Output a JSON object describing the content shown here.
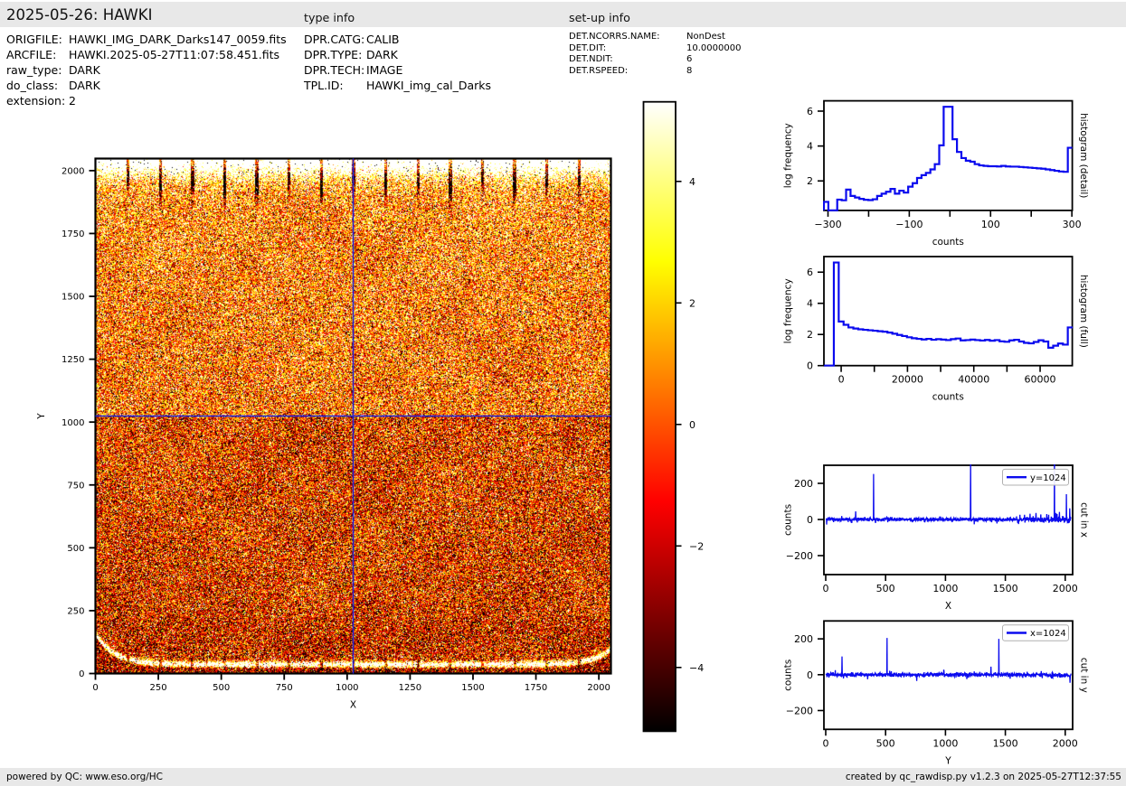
{
  "header": {
    "title": "2025-05-26: HAWKI",
    "type_info_heading": "type info",
    "setup_info_heading": "set-up info"
  },
  "file_info": {
    "rows": [
      {
        "label": "ORIGFILE:",
        "value": "HAWKI_IMG_DARK_Darks147_0059.fits"
      },
      {
        "label": "ARCFILE:",
        "value": "HAWKI.2025-05-27T11:07:58.451.fits"
      },
      {
        "label": "raw_type:",
        "value": "DARK"
      },
      {
        "label": "do_class:",
        "value": "DARK"
      },
      {
        "label": "extension:",
        "value": "2"
      }
    ]
  },
  "type_info": {
    "rows": [
      {
        "label": "DPR.CATG:",
        "value": "CALIB"
      },
      {
        "label": "DPR.TYPE:",
        "value": "DARK"
      },
      {
        "label": "DPR.TECH:",
        "value": "IMAGE"
      },
      {
        "label": "TPL.ID:",
        "value": "HAWKI_img_cal_Darks"
      }
    ]
  },
  "setup_info": {
    "rows": [
      {
        "label": "DET.NCORRS.NAME:",
        "value": "NonDest"
      },
      {
        "label": "DET.DIT:",
        "value": "10.0000000"
      },
      {
        "label": "DET.NDIT:",
        "value": "6"
      },
      {
        "label": "DET.RSPEED:",
        "value": "8"
      }
    ]
  },
  "footer": {
    "left": "powered by QC: www.eso.org/HC",
    "right": "created by qc_rawdisp.py v1.2.3 on 2025-05-27T12:37:55"
  },
  "colors": {
    "line_blue": "#0b0bee",
    "crosshair_blue": "#2222d6",
    "bar_gray": "#e8e8e8",
    "legend_edge": "#b0b0b0",
    "black": "#000000"
  },
  "chart_data": [
    {
      "name": "detector_image",
      "type": "heatmap",
      "xlabel": "X",
      "ylabel": "Y",
      "xlim": [
        0,
        2048
      ],
      "ylim": [
        0,
        2048
      ],
      "xticks": [
        0,
        250,
        500,
        750,
        1000,
        1250,
        1500,
        1750,
        2000
      ],
      "yticks": [
        0,
        250,
        500,
        750,
        1000,
        1250,
        1500,
        1750,
        2000
      ],
      "colormap": "hot",
      "clim": [
        -5.05,
        5.31
      ],
      "crosshair": {
        "x": 1024,
        "y": 1024
      },
      "colorbar_ticks": [
        {
          "v": 4,
          "l": "4"
        },
        {
          "v": 2,
          "l": "2"
        },
        {
          "v": 0,
          "l": "0"
        },
        {
          "v": -2,
          "l": "−2"
        },
        {
          "v": -4,
          "l": "−4"
        }
      ],
      "features": {
        "description": "noisy dark-frame with bright top edge band, dark channel streaks every 128 px hanging from the top, brighter upper half, darker lower half, bright curved band near the bottom edge and faint bright columns",
        "seed": 1234567,
        "noise_sigma": 2.85,
        "upper_mean": 0.6,
        "upper_grad": 0.7,
        "lower_mean": -0.55,
        "lower_grad": -0.4,
        "top_band_amp": 7.5,
        "top_band_scale": 60,
        "top_fade_amp": 1.6,
        "top_fade_scale": 140,
        "streak_every": 128,
        "streak_halfwidth": 6,
        "streak_amp": 11,
        "streak_depths": [
          72,
          110,
          95,
          130,
          118,
          88,
          125,
          70,
          105,
          92,
          122,
          78,
          112,
          98,
          85
        ],
        "smile_base": 38,
        "smile_left_amp": 120,
        "smile_left_scale": 75,
        "smile_right_amp": 62,
        "smile_right_scale": 70,
        "smile_amp": 9.5,
        "smile_sigma": 11,
        "dark_below_smile": 1.5,
        "dark_zone_amp": 0.55,
        "dark_zone_y": 140,
        "dark_zone_sigma": 90,
        "bright_cols": [
          192,
          448,
          704,
          960,
          1216,
          1472,
          1728,
          1984
        ],
        "bright_col_amp": 1.2,
        "bright_col_scale": 320,
        "tall_col_x": 1408,
        "tall_col_amp": 0.6,
        "salt_frac": 0.015,
        "pepper_frac": 0.015
      }
    },
    {
      "name": "histogram_detail",
      "type": "step-histogram",
      "title": "",
      "xlabel": "counts",
      "ylabel": "log frequency",
      "right_label": "histogram (detail)",
      "xlim": [
        -310,
        301
      ],
      "ylim": [
        0.31,
        6.59
      ],
      "xticks": [
        {
          "v": -300,
          "l": "−300"
        },
        {
          "v": -200
        },
        {
          "v": -100,
          "l": "−100"
        },
        {
          "v": 0
        },
        {
          "v": 100,
          "l": "100"
        },
        {
          "v": 200
        },
        {
          "v": 300,
          "l": "300"
        }
      ],
      "yticks": [
        {
          "v": 2,
          "l": "2"
        },
        {
          "v": 4,
          "l": "4"
        },
        {
          "v": 6,
          "l": "6"
        }
      ],
      "bin_start": -310,
      "bin_width": 10.91,
      "values": [
        0.8,
        0.31,
        0.31,
        0.93,
        0.89,
        1.5,
        1.14,
        1.05,
        0.97,
        0.92,
        0.9,
        0.95,
        1.14,
        1.27,
        1.38,
        1.54,
        1.27,
        1.44,
        1.33,
        1.67,
        1.87,
        2.17,
        2.33,
        2.46,
        2.66,
        2.96,
        4.04,
        6.25,
        6.25,
        4.39,
        3.66,
        3.31,
        3.16,
        3.1,
        2.96,
        2.89,
        2.86,
        2.84,
        2.84,
        2.83,
        2.86,
        2.83,
        2.82,
        2.82,
        2.8,
        2.78,
        2.76,
        2.74,
        2.72,
        2.7,
        2.66,
        2.62,
        2.58,
        2.54,
        2.52,
        3.9
      ]
    },
    {
      "name": "histogram_full",
      "type": "step-histogram",
      "title": "",
      "xlabel": "counts",
      "ylabel": "log frequency",
      "right_label": "histogram (full)",
      "xlim": [
        -5200,
        69700
      ],
      "ylim": [
        0,
        7
      ],
      "xticks": [
        {
          "v": 0,
          "l": "0"
        },
        {
          "v": 10000
        },
        {
          "v": 20000,
          "l": "20000"
        },
        {
          "v": 30000
        },
        {
          "v": 40000,
          "l": "40000"
        },
        {
          "v": 50000
        },
        {
          "v": 60000,
          "l": "60000"
        }
      ],
      "yticks": [
        {
          "v": 0,
          "l": "0"
        },
        {
          "v": 2,
          "l": "2"
        },
        {
          "v": 4,
          "l": "4"
        },
        {
          "v": 6,
          "l": "6"
        }
      ],
      "bin_start": -5150,
      "bin_width": 1470,
      "values": [
        0,
        0,
        6.62,
        2.83,
        2.62,
        2.45,
        2.38,
        2.33,
        2.3,
        2.27,
        2.24,
        2.21,
        2.18,
        2.12,
        2.05,
        1.97,
        1.9,
        1.82,
        1.76,
        1.72,
        1.68,
        1.72,
        1.66,
        1.7,
        1.67,
        1.64,
        1.7,
        1.74,
        1.62,
        1.64,
        1.67,
        1.64,
        1.61,
        1.65,
        1.6,
        1.64,
        1.56,
        1.53,
        1.62,
        1.66,
        1.55,
        1.46,
        1.43,
        1.52,
        1.63,
        1.55,
        1.15,
        1.28,
        1.42,
        1.35,
        2.45
      ]
    },
    {
      "name": "cut_in_x",
      "type": "line",
      "title": "",
      "xlabel": "X",
      "ylabel": "counts",
      "right_label": "cut in x",
      "legend": "y=1024",
      "xlim": [
        -15,
        2062
      ],
      "ylim": [
        -305,
        300
      ],
      "xticks": [
        {
          "v": 0,
          "l": "0"
        },
        {
          "v": 500,
          "l": "500"
        },
        {
          "v": 1000,
          "l": "1000"
        },
        {
          "v": 1500,
          "l": "1500"
        },
        {
          "v": 2000,
          "l": "2000"
        }
      ],
      "yticks": [
        {
          "v": -200,
          "l": "−200"
        },
        {
          "v": 0,
          "l": "0"
        },
        {
          "v": 200,
          "l": "200"
        }
      ],
      "noise": {
        "seed": 97531,
        "sigma": 5.2,
        "sigma_tail": 7.5,
        "tail_start": 1550
      },
      "spikes": [
        [
          8,
          -28
        ],
        [
          250,
          45
        ],
        [
          400,
          252
        ],
        [
          1210,
          340
        ],
        [
          1240,
          -27
        ],
        [
          1430,
          -22
        ],
        [
          1660,
          26
        ],
        [
          1705,
          32
        ],
        [
          1755,
          36
        ],
        [
          1795,
          28
        ],
        [
          1845,
          30
        ],
        [
          1909,
          345
        ],
        [
          1922,
          36
        ],
        [
          1952,
          42
        ],
        [
          2009,
          140
        ],
        [
          2038,
          62
        ]
      ]
    },
    {
      "name": "cut_in_y",
      "type": "line",
      "title": "",
      "xlabel": "Y",
      "ylabel": "counts",
      "right_label": "cut in y",
      "legend": "x=1024",
      "xlim": [
        -15,
        2062
      ],
      "ylim": [
        -305,
        300
      ],
      "xticks": [
        {
          "v": 0,
          "l": "0"
        },
        {
          "v": 500,
          "l": "500"
        },
        {
          "v": 1000,
          "l": "1000"
        },
        {
          "v": 1500,
          "l": "1500"
        },
        {
          "v": 2000,
          "l": "2000"
        }
      ],
      "yticks": [
        {
          "v": -200,
          "l": "−200"
        },
        {
          "v": 0,
          "l": "0"
        },
        {
          "v": 200,
          "l": "200"
        }
      ],
      "noise": {
        "seed": 24680,
        "sigma": 6.0,
        "sigma_tail": 7.0,
        "tail_start": 1850,
        "tail_bias": -5
      },
      "spikes": [
        [
          80,
          25
        ],
        [
          136,
          102
        ],
        [
          350,
          -25
        ],
        [
          511,
          205
        ],
        [
          760,
          -35
        ],
        [
          985,
          28
        ],
        [
          1380,
          45
        ],
        [
          1445,
          200
        ],
        [
          1540,
          -22
        ],
        [
          1800,
          20
        ],
        [
          2040,
          -45
        ]
      ]
    }
  ]
}
